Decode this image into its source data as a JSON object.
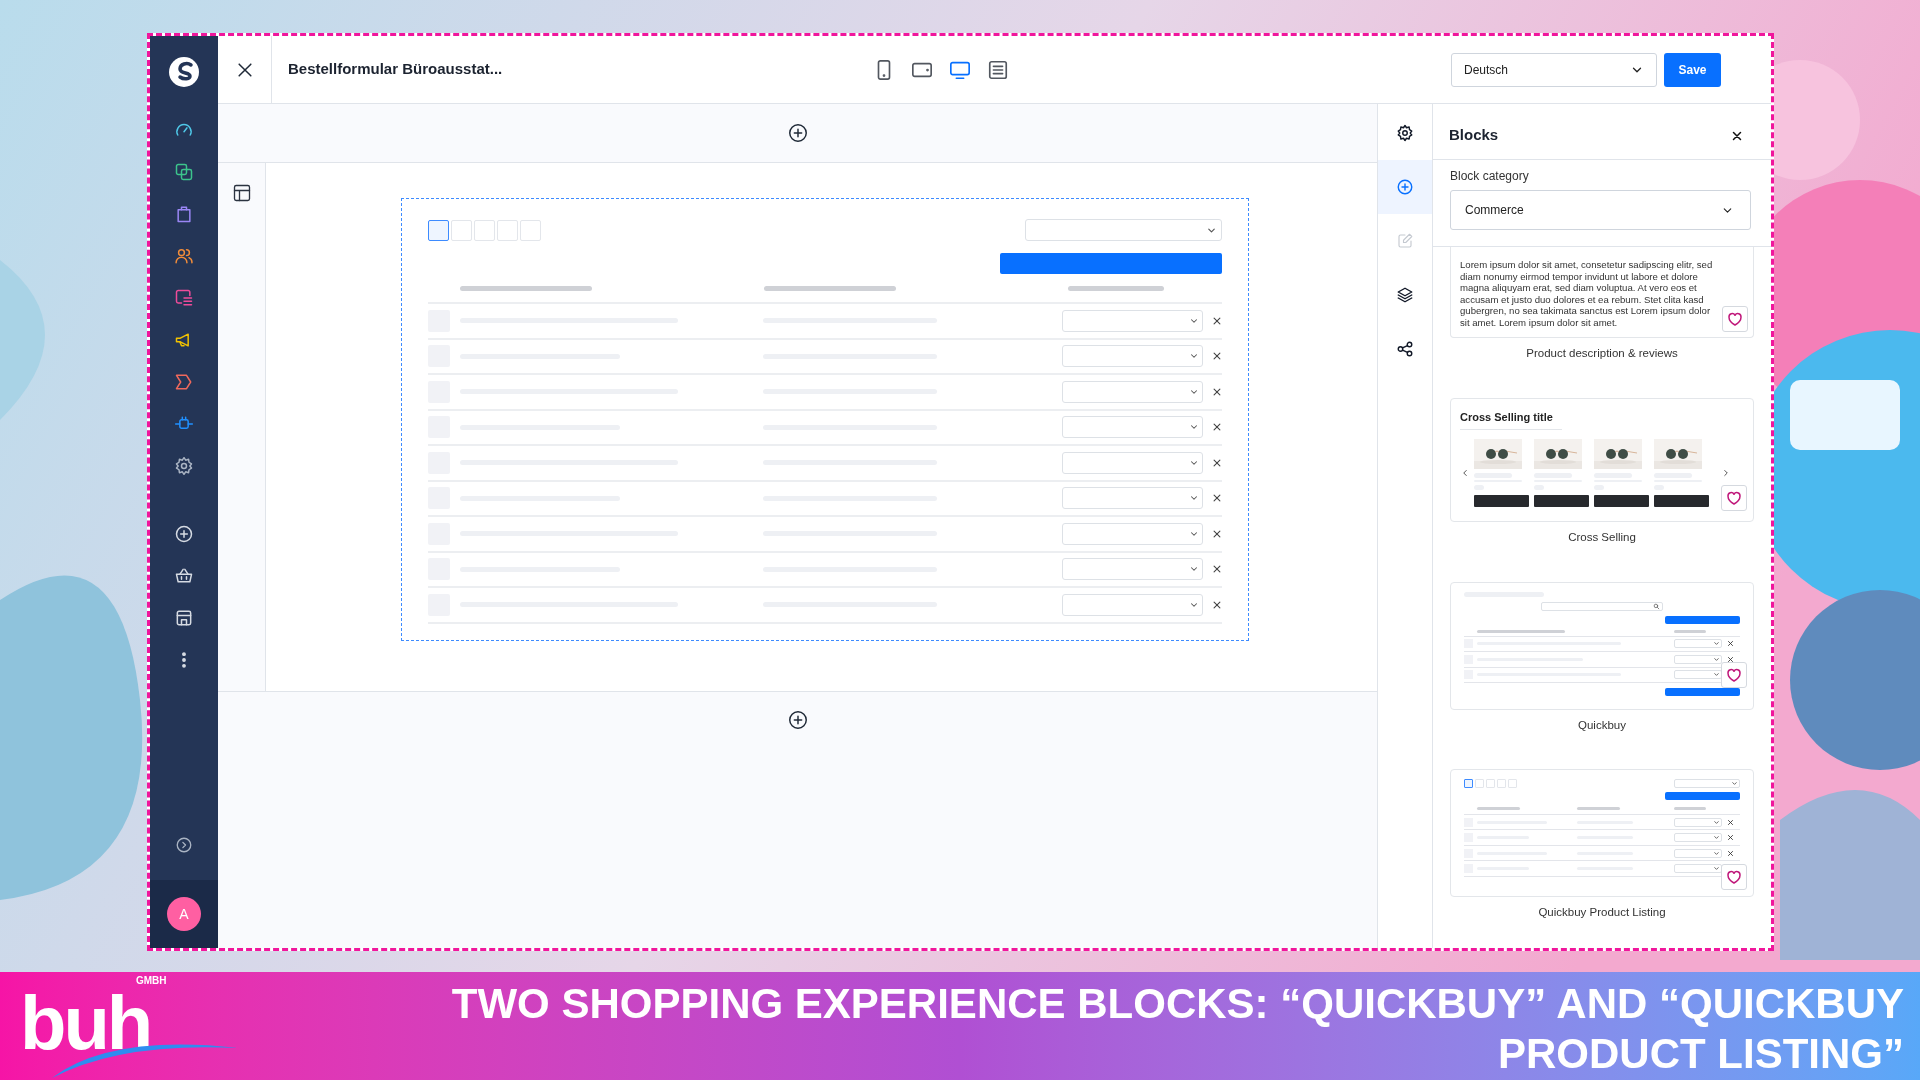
{
  "header": {
    "title": "Bestellformular Büroausstat...",
    "devices": [
      {
        "kind": "mobile",
        "selected": false
      },
      {
        "kind": "tablet",
        "selected": false
      },
      {
        "kind": "desktop",
        "selected": true
      },
      {
        "kind": "list",
        "selected": false
      }
    ],
    "language": "Deutsch",
    "save": "Save"
  },
  "sidebar": {
    "items": [
      {
        "kind": "dashboard",
        "color": "#4fc8e8"
      },
      {
        "kind": "catalogue",
        "color": "#3cc48c"
      },
      {
        "kind": "orders",
        "color": "#9a86f5"
      },
      {
        "kind": "customers",
        "color": "#f08c3a"
      },
      {
        "kind": "content",
        "color": "#ee4c9a"
      },
      {
        "kind": "marketing",
        "color": "#f2c200"
      },
      {
        "kind": "promotions",
        "color": "#f0695c"
      },
      {
        "kind": "extensions",
        "color": "#2090ff"
      },
      {
        "kind": "settings",
        "color": "#aab4c3"
      },
      {
        "kind": "add",
        "color": "#d6dbe3"
      },
      {
        "kind": "basket",
        "color": "#d6dbe3"
      },
      {
        "kind": "store",
        "color": "#d6dbe3"
      },
      {
        "kind": "more",
        "color": "#d6dbe3"
      }
    ],
    "avatar": "A"
  },
  "tools": [
    {
      "kind": "settings",
      "selected": false,
      "disabled": false
    },
    {
      "kind": "add",
      "selected": true,
      "disabled": false
    },
    {
      "kind": "edit",
      "selected": false,
      "disabled": true
    },
    {
      "kind": "layers",
      "selected": false,
      "disabled": false
    },
    {
      "kind": "share",
      "selected": false,
      "disabled": false
    }
  ],
  "blocks_panel": {
    "title": "Blocks",
    "category_label": "Block category",
    "category": "Commerce",
    "blocks": [
      {
        "kind": "description",
        "text": "Lorem ipsum dolor sit amet, consetetur sadipscing elitr, sed diam nonumy eirmod tempor invidunt ut labore et dolore magna aliquyam erat, sed diam voluptua. At vero eos et accusam et justo duo dolores et ea rebum. Stet clita kasd gubergren, no sea takimata sanctus est Lorem ipsum dolor sit amet. Lorem ipsum dolor sit amet.",
        "label": "Product description & reviews"
      },
      {
        "kind": "cross_selling",
        "title": "Cross Selling title",
        "label": "Cross Selling"
      },
      {
        "kind": "quickbuy",
        "label": "Quickbuy"
      },
      {
        "kind": "quickbuy_listing",
        "label": "Quickbuy Product Listing"
      }
    ]
  },
  "banner": {
    "logo": "buh",
    "logo_suffix": "GMBH",
    "title": "TWO SHOPPING EXPERIENCE BLOCKS: “QUICKBUY” AND “QUICKBUY PRODUCT LISTING”"
  }
}
